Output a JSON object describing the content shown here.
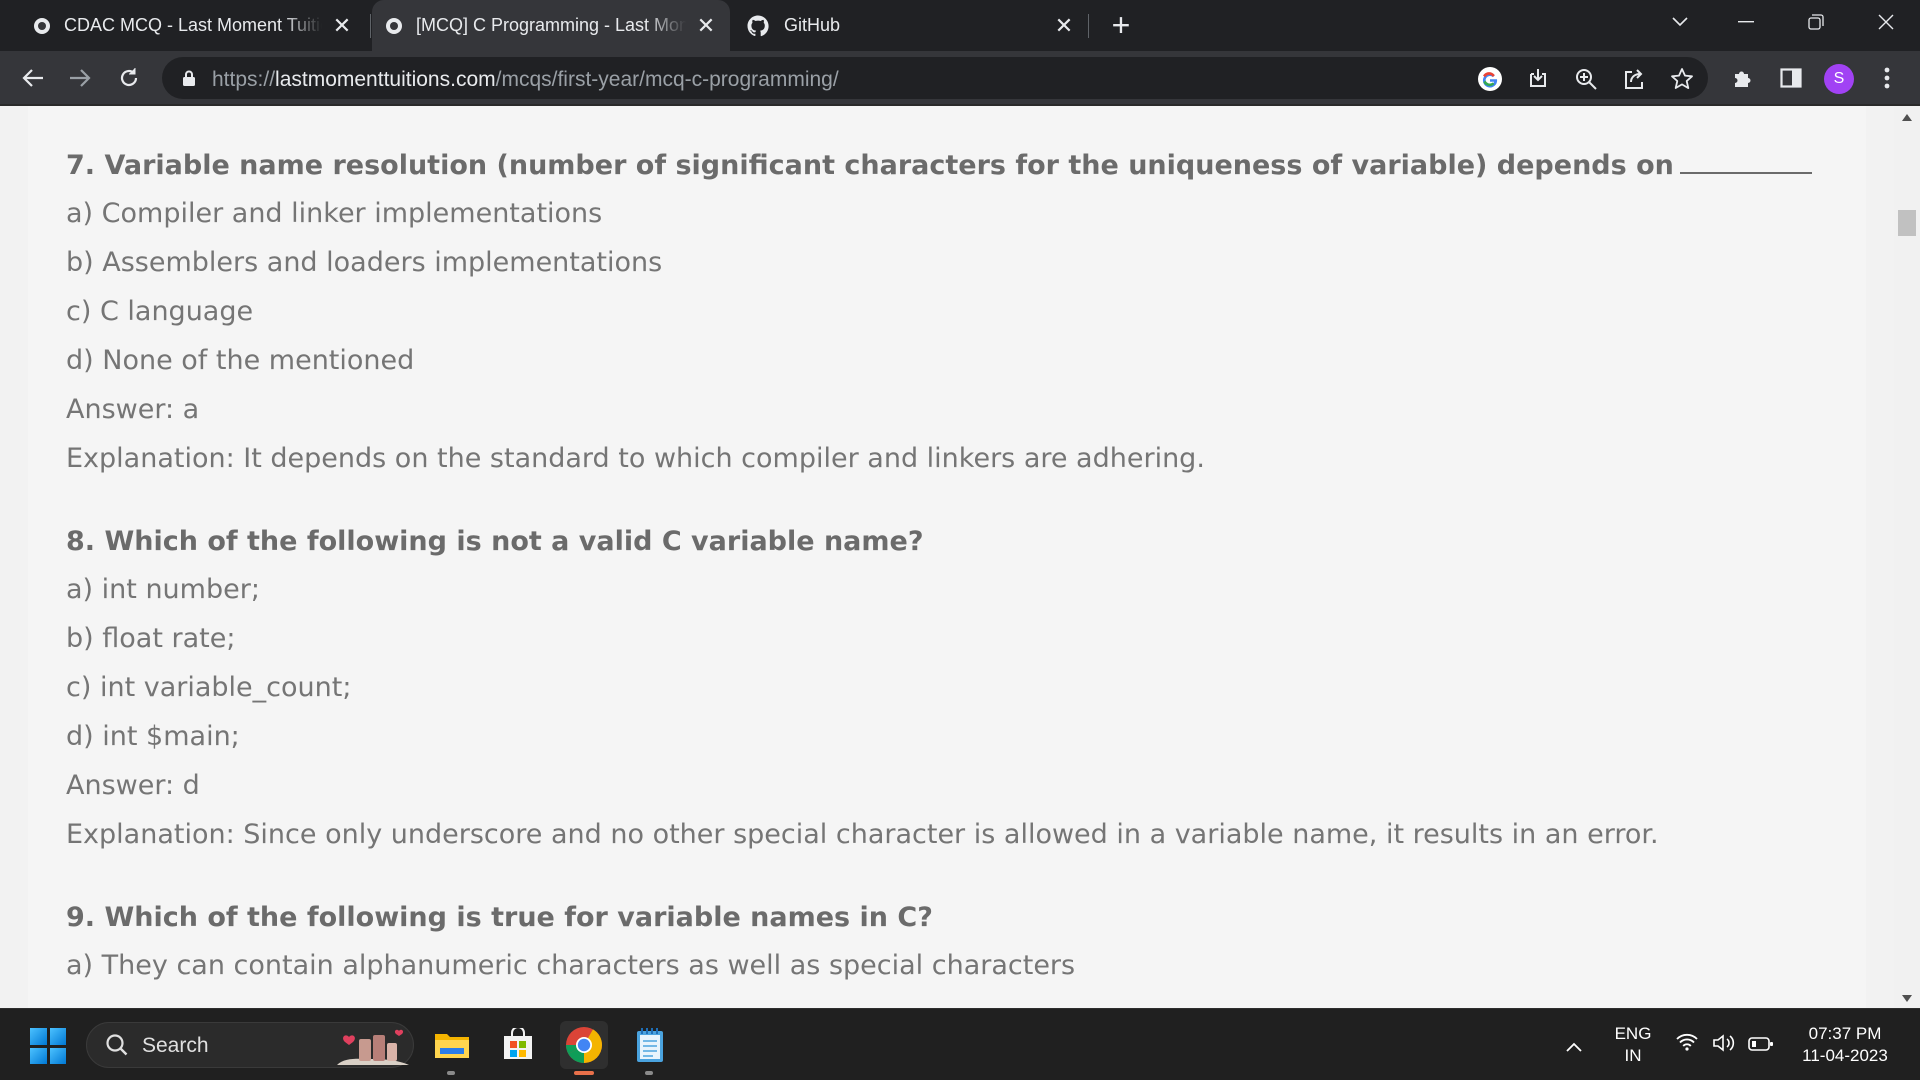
{
  "browser": {
    "tabs": [
      {
        "title": "CDAC MCQ - Last Moment Tuitions",
        "active": false
      },
      {
        "title": "[MCQ] C Programming - Last Moment Tuitions",
        "active": true
      },
      {
        "title": "GitHub",
        "active": false
      }
    ],
    "new_tab_label": "+",
    "url_scheme": "https://",
    "url_host": "lastmomenttuitions.com",
    "url_path": "/mcqs/first-year/mcq-c-programming/",
    "profile_initial": "S"
  },
  "questions": [
    {
      "title": "7. Variable name resolution (number of significant characters for the uniqueness of variable) depends on",
      "options": [
        "a) Compiler and linker implementations",
        "b) Assemblers and loaders implementations",
        "c) C language",
        "d) None of the mentioned"
      ],
      "answer": "Answer: a",
      "explanation": "Explanation: It depends on the standard to which compiler and linkers are adhering."
    },
    {
      "title": "8. Which of the following is not a valid C variable name?",
      "options": [
        "a) int number;",
        "b) float rate;",
        "c) int variable_count;",
        "d) int $main;"
      ],
      "answer": "Answer: d",
      "explanation": "Explanation: Since only underscore and no other special character is allowed in a variable name, it results in an error."
    },
    {
      "title": "9. Which of the following is true for variable names in C?",
      "options": [
        "a) They can contain alphanumeric characters as well as special characters"
      ]
    }
  ],
  "taskbar": {
    "search_label": "Search",
    "language_line1": "ENG",
    "language_line2": "IN",
    "time": "07:37 PM",
    "date": "11-04-2023"
  },
  "colors": {
    "browser_frame": "#202124",
    "toolbar": "#35363a",
    "page_background": "#f5f5f5",
    "text": "#757575",
    "profile": "#a142f4"
  }
}
